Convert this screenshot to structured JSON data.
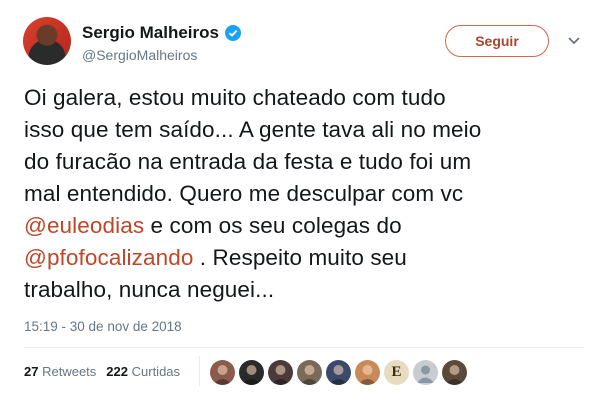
{
  "user": {
    "name": "Sergio Malheiros",
    "handle": "@SergioMalheiros",
    "verified": true
  },
  "follow_button": {
    "label": "Seguir"
  },
  "tweet": {
    "lines": [
      [
        {
          "text": "Oi galera, estou muito chateado com tudo"
        }
      ],
      [
        {
          "text": "isso que tem saído... A gente tava ali no meio"
        }
      ],
      [
        {
          "text": "do furacão na entrada da festa e tudo foi um"
        }
      ],
      [
        {
          "text": "mal entendido. Quero me desculpar com vc"
        }
      ],
      [
        {
          "text": "@euleodias",
          "mention": true
        },
        {
          "text": " e com os seu colegas do"
        }
      ],
      [
        {
          "text": "@pfofocalizando",
          "mention": true
        },
        {
          "text": " . Respeito muito seu"
        }
      ],
      [
        {
          "text": "trabalho, nunca neguei..."
        }
      ]
    ],
    "timestamp": "15:19 - 30 de nov de 2018"
  },
  "stats": {
    "retweets_count": "27",
    "retweets_label": "Retweets",
    "likes_count": "222",
    "likes_label": "Curtidas"
  },
  "likers": [
    {
      "color": "#8a5a4a"
    },
    {
      "color": "#2a2a2a"
    },
    {
      "color": "#4a3a3a"
    },
    {
      "color": "#7a6a5a"
    },
    {
      "color": "#3a4a6a"
    },
    {
      "color": "#c98a5a"
    },
    {
      "color": "#e8dcc0",
      "letter": "E"
    },
    {
      "color": "#c8ccd0",
      "default": true
    },
    {
      "color": "#5a4a3a"
    }
  ],
  "colors": {
    "accent": "#c0462a",
    "verified": "#1da1f2",
    "muted": "#657786"
  }
}
